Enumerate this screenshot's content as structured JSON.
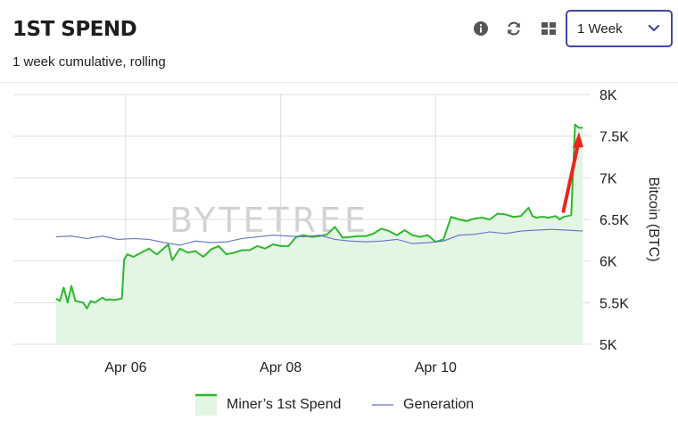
{
  "header": {
    "title": "1ST SPEND",
    "subtitle": "1 week cumulative, rolling",
    "icons": [
      "info-icon",
      "refresh-icon",
      "grid-icon"
    ],
    "period_select": {
      "value": "1 Week"
    }
  },
  "watermark": "BYTETREE",
  "colors": {
    "spend_line": "#2db82d",
    "spend_fill": "#e3f5e3",
    "generation_line": "#6670c8",
    "arrow": "#e8271e",
    "select_border": "#3f47a8"
  },
  "chart_data": {
    "type": "line",
    "y_axis_label": "Bitcoin (BTC)",
    "y_ticks": [
      "8K",
      "7.5K",
      "7K",
      "6.5K",
      "6K",
      "5.5K",
      "5K"
    ],
    "ylim": [
      5000,
      8000
    ],
    "x_ticks": [
      "Apr 06",
      "Apr 08",
      "Apr 10"
    ],
    "grid": true,
    "legend_position": "bottom",
    "annotation": "red arrow pointing to latest spike",
    "series": [
      {
        "name": "Miner's 1st Spend",
        "style": "line-with-area",
        "x_days": [
          0,
          0.05,
          0.1,
          0.15,
          0.2,
          0.25,
          0.3,
          0.35,
          0.4,
          0.45,
          0.5,
          0.55,
          0.6,
          0.65,
          0.7,
          0.75,
          0.8,
          0.85,
          0.88,
          0.92,
          1.0,
          1.1,
          1.2,
          1.3,
          1.45,
          1.5,
          1.6,
          1.7,
          1.8,
          1.9,
          2.0,
          2.1,
          2.2,
          2.3,
          2.4,
          2.5,
          2.6,
          2.7,
          2.8,
          2.9,
          3.0,
          3.1,
          3.2,
          3.3,
          3.4,
          3.5,
          3.6,
          3.7,
          3.8,
          3.9,
          4.0,
          4.1,
          4.2,
          4.3,
          4.4,
          4.5,
          4.6,
          4.7,
          4.8,
          4.9,
          5.0,
          5.1,
          5.2,
          5.3,
          5.4,
          5.5,
          5.6,
          5.7,
          5.8,
          5.9,
          6.0,
          6.1,
          6.15,
          6.2,
          6.25,
          6.3,
          6.35,
          6.4,
          6.45,
          6.5,
          6.55,
          6.6,
          6.65,
          6.7,
          6.75,
          6.8
        ],
        "values": [
          5550,
          5520,
          5680,
          5500,
          5700,
          5520,
          5510,
          5500,
          5430,
          5520,
          5500,
          5530,
          5560,
          5530,
          5540,
          5530,
          5540,
          5550,
          6020,
          6080,
          6050,
          6100,
          6150,
          6080,
          6200,
          6010,
          6150,
          6100,
          6120,
          6050,
          6140,
          6180,
          6080,
          6100,
          6130,
          6130,
          6180,
          6150,
          6200,
          6180,
          6180,
          6290,
          6310,
          6290,
          6300,
          6320,
          6410,
          6280,
          6290,
          6300,
          6300,
          6330,
          6390,
          6360,
          6310,
          6370,
          6310,
          6290,
          6310,
          6230,
          6260,
          6530,
          6500,
          6480,
          6510,
          6520,
          6500,
          6570,
          6560,
          6530,
          6540,
          6640,
          6540,
          6520,
          6530,
          6530,
          6520,
          6530,
          6540,
          6500,
          6530,
          6540,
          6550,
          7640,
          7600,
          7600
        ]
      },
      {
        "name": "Generation",
        "style": "line",
        "x_days": [
          0,
          0.2,
          0.4,
          0.6,
          0.8,
          1.0,
          1.2,
          1.4,
          1.6,
          1.8,
          2.0,
          2.2,
          2.4,
          2.6,
          2.8,
          3.0,
          3.2,
          3.4,
          3.6,
          3.8,
          4.0,
          4.2,
          4.4,
          4.6,
          4.8,
          5.0,
          5.2,
          5.4,
          5.6,
          5.8,
          6.0,
          6.2,
          6.4,
          6.6,
          6.8
        ],
        "values": [
          6290,
          6300,
          6270,
          6300,
          6260,
          6270,
          6260,
          6220,
          6190,
          6240,
          6220,
          6230,
          6270,
          6290,
          6310,
          6300,
          6290,
          6310,
          6260,
          6240,
          6230,
          6240,
          6260,
          6210,
          6220,
          6240,
          6310,
          6320,
          6350,
          6330,
          6360,
          6370,
          6380,
          6370,
          6360
        ]
      }
    ]
  },
  "legend": {
    "spend_label": "Miner’s 1st Spend",
    "generation_label": "Generation"
  }
}
